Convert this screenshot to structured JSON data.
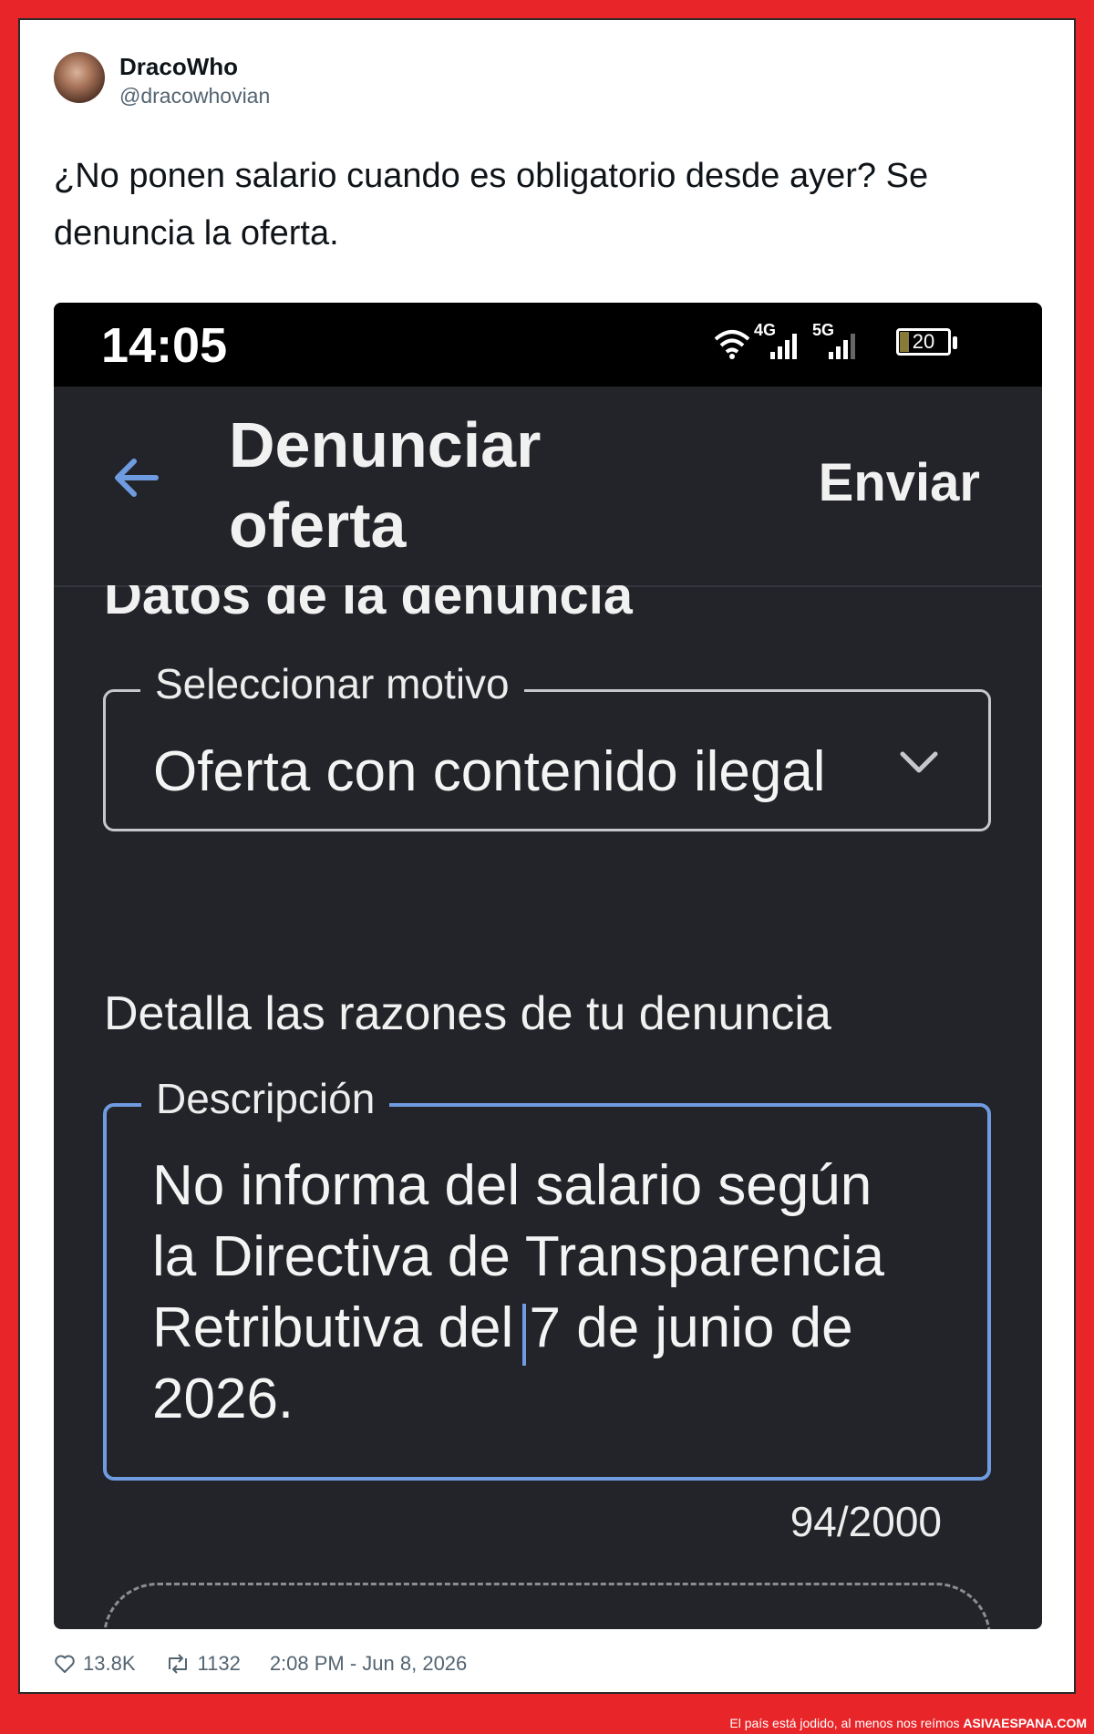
{
  "tweet": {
    "author_name": "DracoWho",
    "author_handle": "@dracowhovian",
    "text": "¿No ponen salario cuando es obligatorio desde ayer? Se denuncia la oferta.",
    "likes": "13.8K",
    "retweets": "1132",
    "timestamp": "2:08 PM - Jun 8, 2026"
  },
  "phone": {
    "status_bar": {
      "time": "14:05",
      "network_1": "4G",
      "network_2": "5G",
      "battery": "20"
    },
    "app_bar": {
      "title": "Denunciar oferta",
      "action": "Enviar"
    },
    "section_title": "Datos de la denuncia",
    "reason_select": {
      "label": "Seleccionar motivo",
      "value": "Oferta con contenido ilegal"
    },
    "details_title": "Detalla las razones de tu denuncia",
    "description": {
      "label": "Descripción",
      "value": "No informa del salario según la Directiva de Transparencia Retributiva del 7 de junio de 2026.",
      "counter": "94/2000"
    }
  },
  "footer": {
    "tagline": "El país está jodido, al menos nos reímos",
    "site": "ASIVAESPANA.COM"
  },
  "colors": {
    "frame": "#e8262a",
    "screen_bg": "#232429",
    "focus_blue": "#6f9be0"
  }
}
